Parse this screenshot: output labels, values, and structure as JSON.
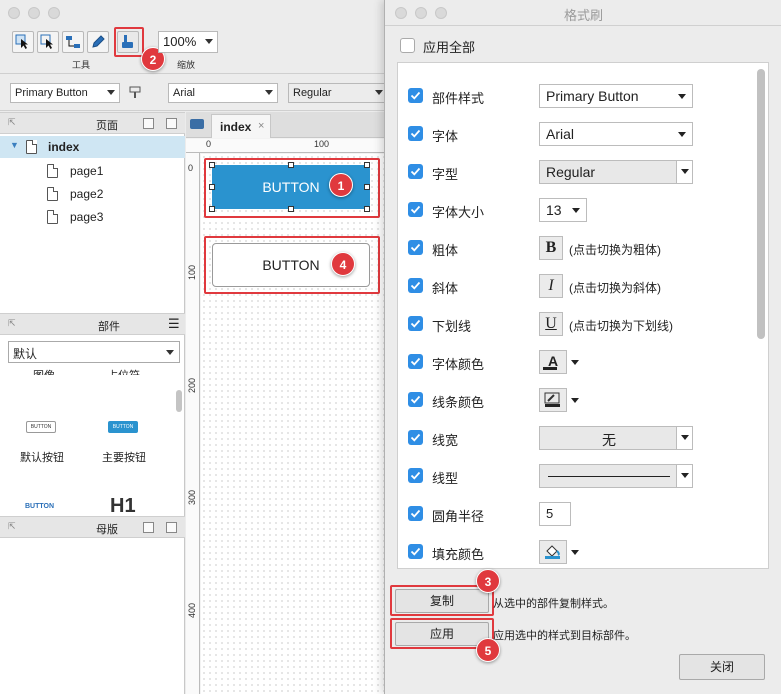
{
  "main_window": {
    "toolbar": {
      "tools_caption": "工具",
      "zoom_caption": "缩放",
      "zoom_value": "100%",
      "tools": [
        "select-intersect-icon",
        "select-contain-icon",
        "connector-icon",
        "pen-icon",
        "format-painter-icon"
      ]
    },
    "format_bar": {
      "style_value": "Primary Button",
      "font_value": "Arial",
      "weight_value": "Regular"
    },
    "pages_panel": {
      "title": "页面",
      "root": "index",
      "pages": [
        "page1",
        "page2",
        "page3"
      ]
    },
    "widgets_panel": {
      "title": "部件",
      "library": "默认",
      "partial_labels": [
        "图像",
        "占位符"
      ],
      "items": [
        {
          "thumb": "BUTTON",
          "label": "默认按钮"
        },
        {
          "thumb": "BUTTON",
          "label": "主要按钮"
        }
      ],
      "next_row": [
        "BUTTON",
        "H1"
      ]
    },
    "masters_panel": {
      "title": "母版"
    },
    "canvas": {
      "tab_label": "index",
      "ruler_top": [
        "0",
        "100"
      ],
      "ruler_left": [
        "0",
        "100",
        "200",
        "300",
        "400"
      ],
      "button_primary": "BUTTON",
      "button_default": "BUTTON"
    }
  },
  "dialog": {
    "title": "格式刷",
    "apply_all_label": "应用全部",
    "properties": [
      {
        "label": "部件样式",
        "control": "dropdown",
        "value": "Primary Button"
      },
      {
        "label": "字体",
        "control": "dropdown",
        "value": "Arial"
      },
      {
        "label": "字型",
        "control": "dropdown-gray",
        "value": "Regular"
      },
      {
        "label": "字体大小",
        "control": "small-dropdown",
        "value": "13"
      },
      {
        "label": "粗体",
        "control": "toggle",
        "glyph": "B",
        "hint": "(点击切换为粗体)"
      },
      {
        "label": "斜体",
        "control": "toggle",
        "glyph": "I",
        "hint": "(点击切换为斜体)"
      },
      {
        "label": "下划线",
        "control": "toggle",
        "glyph": "U",
        "hint": "(点击切换为下划线)"
      },
      {
        "label": "字体颜色",
        "control": "color",
        "glyph": "A"
      },
      {
        "label": "线条颜色",
        "control": "color",
        "glyph": "line-color-icon"
      },
      {
        "label": "线宽",
        "control": "dropdown-gray",
        "value": "无"
      },
      {
        "label": "线型",
        "control": "line-style"
      },
      {
        "label": "圆角半径",
        "control": "text",
        "value": "5"
      },
      {
        "label": "填充颜色",
        "control": "color",
        "glyph": "fill-bucket-icon"
      }
    ],
    "copy_button": "复制",
    "copy_hint": "从选中的部件复制样式。",
    "apply_button": "应用",
    "apply_hint": "应用选中的样式到目标部件。",
    "close_button": "关闭"
  },
  "markers": [
    "1",
    "2",
    "3",
    "4",
    "5"
  ],
  "colors": {
    "accent_checkbox": "#2f8ee5",
    "marker_red": "#e0393e",
    "primary_button": "#2a93cf"
  }
}
